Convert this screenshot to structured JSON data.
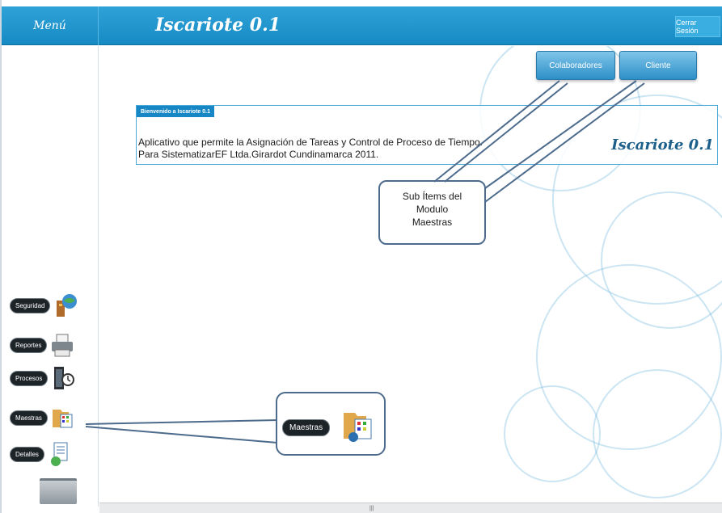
{
  "header": {
    "menu_title": "Menú",
    "app_title": "Iscariote 0.1",
    "logout_label": "Cerrar Sesión"
  },
  "sidebar": {
    "items": [
      {
        "label": "Seguridad",
        "icon": "globe-key-icon"
      },
      {
        "label": "Reportes",
        "icon": "printer-icon"
      },
      {
        "label": "Procesos",
        "icon": "process-clock-icon"
      },
      {
        "label": "Maestras",
        "icon": "folder-grid-icon"
      },
      {
        "label": "Detalles",
        "icon": "document-user-icon"
      }
    ],
    "bottom_icon": "trash-bin-icon"
  },
  "main": {
    "submenu": [
      {
        "label": "Colaboradores"
      },
      {
        "label": "Cliente"
      }
    ],
    "welcome": {
      "tab": "Bienvenido a Iscariote 0.1",
      "line1": "Aplicativo que permite la Asignación de Tareas y Control de Proceso de Tiempo.",
      "line2": "Para SistematizarEF Ltda.Girardot Cundinamarca 2011.",
      "logo": "Iscariote 0.1"
    },
    "callout_sub_items": {
      "line1": "Sub Ítems  del",
      "line2": "Modulo",
      "line3": "Maestras"
    },
    "callout_maestras": {
      "label": "Maestras"
    }
  },
  "colors": {
    "header_blue": "#1d93cc",
    "button_blue": "#2d8fc8",
    "pill_dark": "#1d2428",
    "callout_border": "#4d6b8c"
  }
}
